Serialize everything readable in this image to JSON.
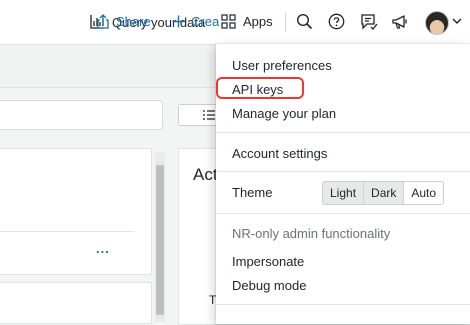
{
  "topbar": {
    "query_label": "Query your data",
    "apps_label": "Apps",
    "icons": [
      "chart-icon",
      "apps-grid-icon",
      "search-icon",
      "help-icon",
      "feedback-icon",
      "megaphone-icon",
      "avatar",
      "chevron-down-icon"
    ]
  },
  "actions": {
    "share_label": "Share",
    "create_label": "Crea"
  },
  "card": {
    "title_fragment": "Act",
    "text_fragment": "T",
    "more_label": "..."
  },
  "menu": {
    "user_preferences": "User preferences",
    "api_keys": "API keys",
    "manage_plan": "Manage your plan",
    "account_settings": "Account settings",
    "theme_label": "Theme",
    "theme_options": [
      "Light",
      "Dark",
      "Auto"
    ],
    "theme_selected": "Auto",
    "admin_heading": "NR-only admin functionality",
    "impersonate": "Impersonate",
    "debug_mode": "Debug mode"
  },
  "colors": {
    "accent_link": "#1a6fa8",
    "highlight_border": "#e53935"
  }
}
